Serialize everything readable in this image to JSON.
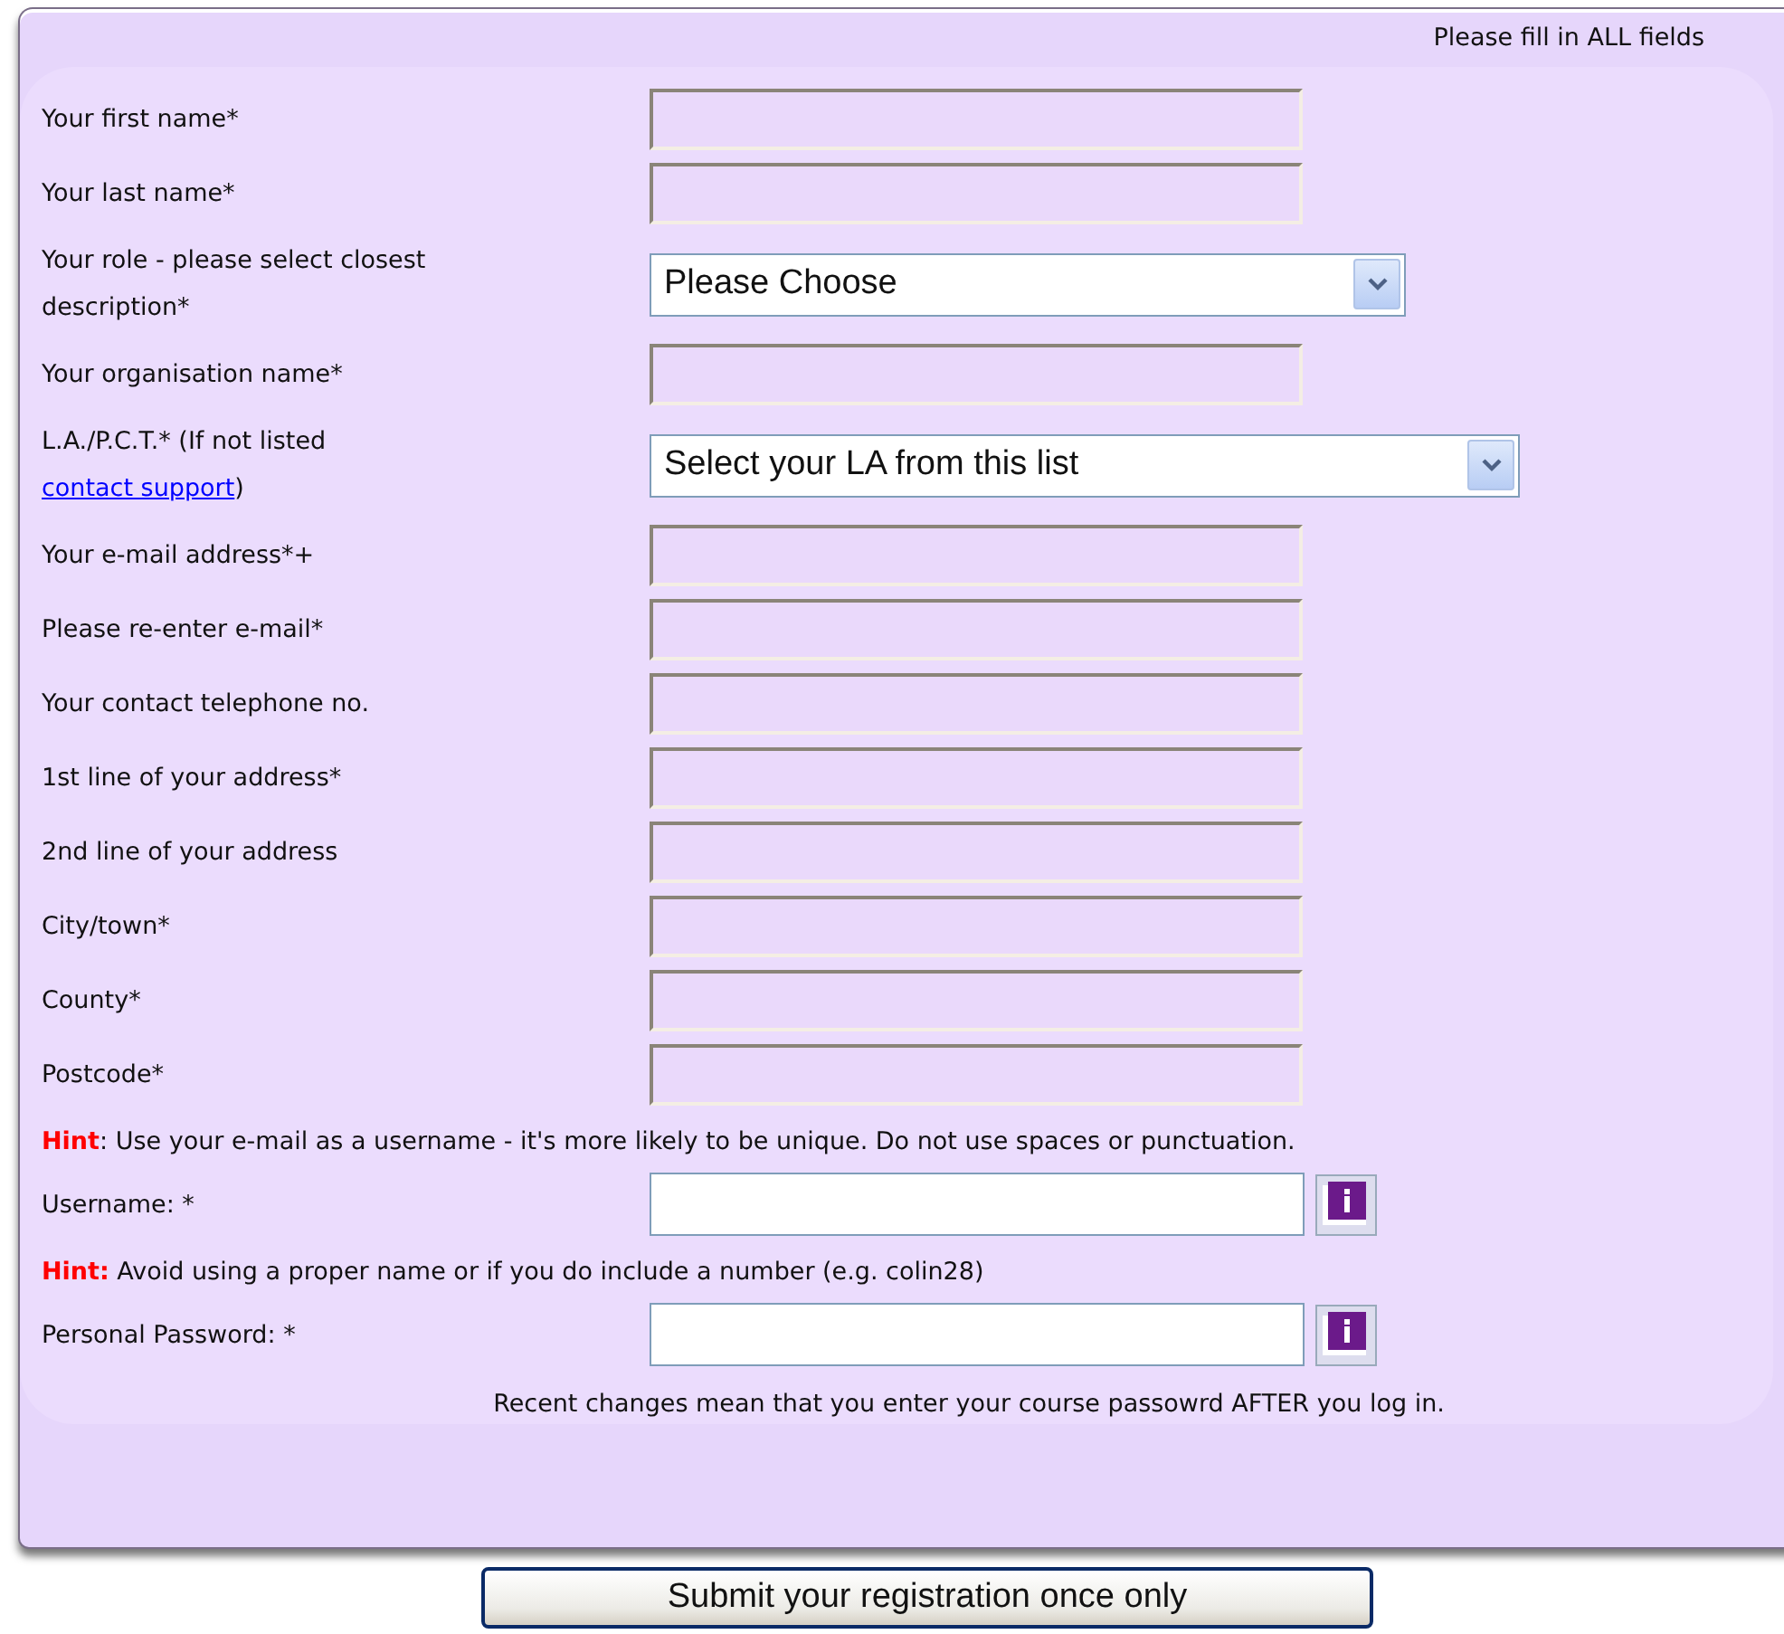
{
  "instruction": "Please fill in ALL fields",
  "rows": [
    {
      "kind": "text",
      "label": "Your first name*"
    },
    {
      "kind": "text",
      "label": "Your last name*"
    },
    {
      "kind": "select",
      "label": "Your role - please select closest description*",
      "value": "Please Choose"
    },
    {
      "kind": "text",
      "label": "Your organisation name*"
    },
    {
      "kind": "wide-select",
      "label": "L.A./P.C.T.* (If not listed ",
      "link": "contact support",
      "label_after": ")",
      "value": "Select your LA from this list"
    },
    {
      "kind": "text",
      "label": "Your e-mail address*+"
    },
    {
      "kind": "text",
      "label": "Please re-enter e-mail*"
    },
    {
      "kind": "text",
      "label": "Your contact telephone no."
    },
    {
      "kind": "text",
      "label": "1st line of your address*"
    },
    {
      "kind": "text",
      "label": "2nd line of your address"
    },
    {
      "kind": "text",
      "label": "City/town*"
    },
    {
      "kind": "text",
      "label": "County*"
    },
    {
      "kind": "text",
      "label": "Postcode*"
    },
    {
      "kind": "hint",
      "lead": "Hint",
      "text": ": Use your e-mail as a username - it's more likely to be unique. Do not use spaces or punctuation."
    },
    {
      "kind": "login",
      "label": "Username: *"
    },
    {
      "kind": "hint",
      "lead": "Hint:",
      "text": " Avoid using a proper name or if you do include a number (e.g. colin28)"
    },
    {
      "kind": "login",
      "label": "Personal Password: *"
    },
    {
      "kind": "note",
      "text": "Recent changes mean that you enter your course passowrd AFTER you log in."
    }
  ],
  "submit": "Submit your registration once only"
}
